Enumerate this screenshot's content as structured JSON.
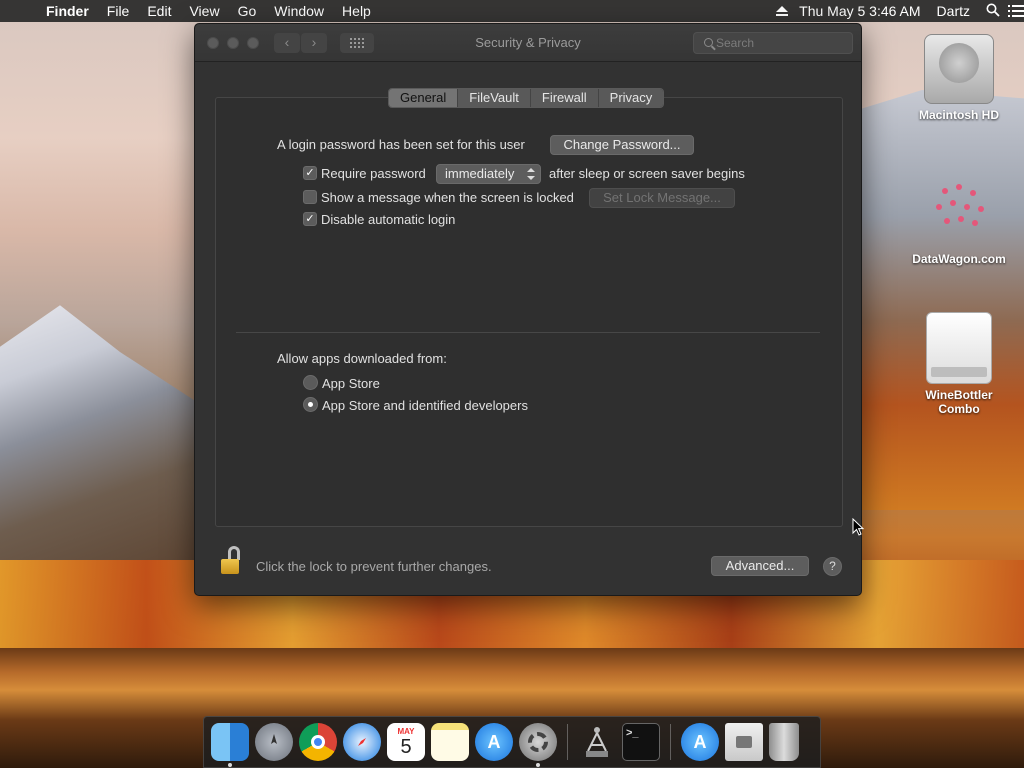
{
  "menubar": {
    "apple": "",
    "app_name": "Finder",
    "items": [
      "File",
      "Edit",
      "View",
      "Go",
      "Window",
      "Help"
    ],
    "datetime": "Thu May 5  3:46 AM",
    "user": "Dartz"
  },
  "window": {
    "title": "Security & Privacy",
    "search_placeholder": "Search",
    "tabs": [
      {
        "label": "General",
        "active": true
      },
      {
        "label": "FileVault",
        "active": false
      },
      {
        "label": "Firewall",
        "active": false
      },
      {
        "label": "Privacy",
        "active": false
      }
    ],
    "general": {
      "login_password_text": "A login password has been set for this user",
      "change_password_label": "Change Password...",
      "require_password": {
        "checked": true,
        "label": "Require password",
        "select_value": "immediately",
        "suffix": "after sleep or screen saver begins"
      },
      "show_message": {
        "checked": false,
        "label": "Show a message when the screen is locked",
        "button_label": "Set Lock Message..."
      },
      "disable_auto_login": {
        "checked": true,
        "label": "Disable automatic login"
      },
      "allow_apps_heading": "Allow apps downloaded from:",
      "allow_apps_options": [
        {
          "label": "App Store",
          "selected": false
        },
        {
          "label": "App Store and identified developers",
          "selected": true
        }
      ]
    },
    "footer": {
      "lock_text": "Click the lock to prevent further changes.",
      "advanced_label": "Advanced...",
      "help_label": "?"
    }
  },
  "desktop_icons": [
    {
      "label": "Macintosh HD",
      "icon": "hard-drive-icon"
    },
    {
      "label": "DataWagon.com",
      "icon": "web-location-icon"
    },
    {
      "label": "WineBottler Combo",
      "icon": "disk-image-icon"
    }
  ],
  "dock": {
    "apps": [
      "Finder",
      "Launchpad",
      "Chrome",
      "Safari",
      "Calendar",
      "Notes",
      "App Store",
      "System Preferences",
      "Directory Utility",
      "Terminal",
      "App Store",
      "Preview",
      "Trash"
    ],
    "calendar_month": "MAY",
    "calendar_day": "5"
  },
  "colors": {
    "window_bg": "#323232",
    "tab_active": "#747474",
    "lock_gold": "#e0b23c"
  }
}
